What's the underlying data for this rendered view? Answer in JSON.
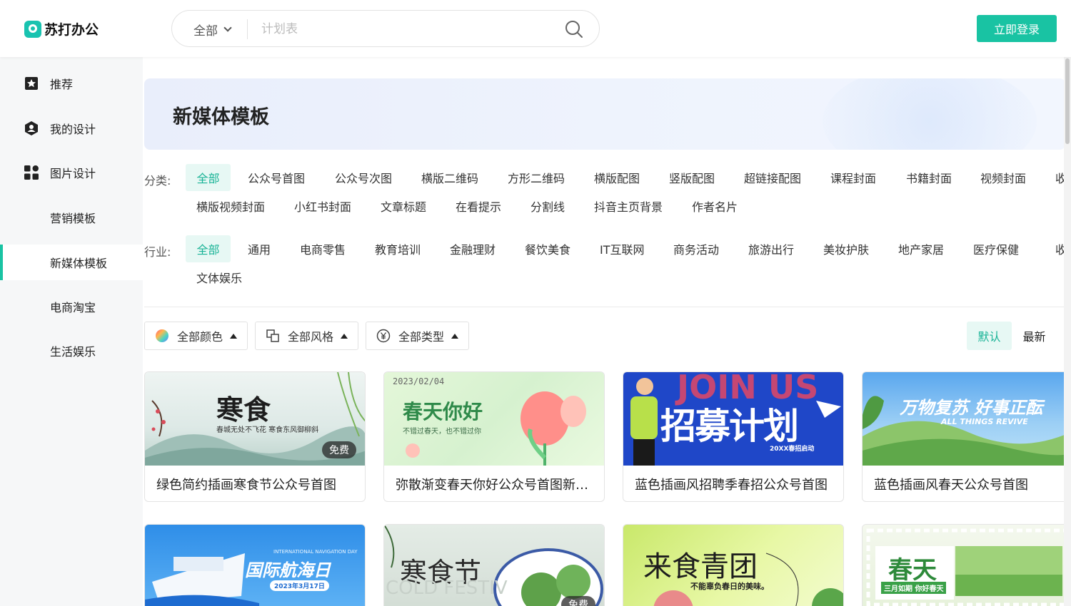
{
  "header": {
    "logo_text": "苏打办公",
    "search": {
      "scope": "全部",
      "placeholder": "计划表"
    },
    "login_label": "立即登录"
  },
  "sidebar": {
    "items": [
      {
        "label": "推荐",
        "icon": "star-bookmark-icon"
      },
      {
        "label": "我的设计",
        "icon": "user-shield-icon"
      },
      {
        "label": "图片设计",
        "icon": "grid-icon"
      },
      {
        "label": "营销模板"
      },
      {
        "label": "新媒体模板",
        "active": true
      },
      {
        "label": "电商淘宝"
      },
      {
        "label": "生活娱乐"
      }
    ]
  },
  "banner": {
    "title": "新媒体模板"
  },
  "category": {
    "label": "分类:",
    "row1": [
      "全部",
      "公众号首图",
      "公众号次图",
      "横版二维码",
      "方形二维码",
      "横版配图",
      "竖版配图",
      "超链接配图",
      "课程封面",
      "书籍封面",
      "视频封面",
      "收"
    ],
    "row2": [
      "横版视频封面",
      "小红书封面",
      "文章标题",
      "在看提示",
      "分割线",
      "抖音主页背景",
      "作者名片"
    ]
  },
  "industry": {
    "label": "行业:",
    "row1": [
      "全部",
      "通用",
      "电商零售",
      "教育培训",
      "金融理财",
      "餐饮美食",
      "IT互联网",
      "商务活动",
      "旅游出行",
      "美妆护肤",
      "地产家居",
      "医疗保健",
      "收"
    ],
    "row2": [
      "文体娱乐"
    ]
  },
  "filters": {
    "color": "全部颜色",
    "style": "全部风格",
    "type": "全部类型"
  },
  "sort": {
    "default": "默认",
    "latest": "最新"
  },
  "cards": [
    {
      "title": "绿色简约插画寒食节公众号首图",
      "badge": "免费",
      "thumb_text": "寒食",
      "thumb_sub": "春城无处不飞花 寒食东风御柳斜"
    },
    {
      "title": "弥散渐变春天你好公众号首图新媒体模板",
      "thumb_text": "春天你好",
      "thumb_date": "2023/02/04",
      "thumb_sub": "不错过春天，也不错过你"
    },
    {
      "title": "蓝色插画风招聘季春招公众号首图",
      "thumb_text": "招募计划",
      "thumb_bg_text": "JOIN US",
      "thumb_sub": "20XX春招启动"
    },
    {
      "title": "蓝色插画风春天公众号首图",
      "thumb_text": "万物复苏 好事正酝",
      "thumb_sub": "ALL THINGS REVIVE"
    },
    {
      "thumb_text": "国际航海日",
      "thumb_sub": "2023年3月17日",
      "thumb_en": "INTERNATIONAL NAVIGATION DAY"
    },
    {
      "thumb_text": "寒食节",
      "badge": "免费",
      "thumb_en": "COLD FESTIV"
    },
    {
      "thumb_text": "来食青团",
      "thumb_sub": "不能辜负春日的美味。"
    },
    {
      "thumb_text": "春天",
      "thumb_sub": "三月如期 你好春天"
    }
  ],
  "colors": {
    "accent": "#19c3a3",
    "accent_light": "#e7f8f4"
  }
}
